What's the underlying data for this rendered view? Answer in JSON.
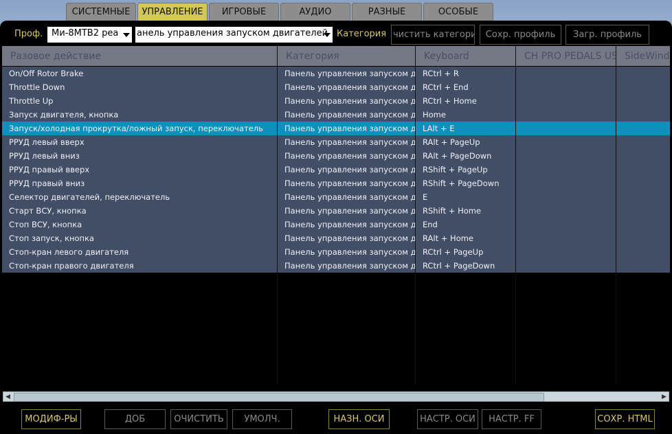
{
  "tabs": [
    "СИСТЕМНЫЕ",
    "УПРАВЛЕНИЕ",
    "ИГРОВЫЕ",
    "АУДИО",
    "РАЗНЫЕ",
    "ОСОБЫЕ"
  ],
  "active_tab": "УПРАВЛЕНИЕ",
  "toolbar": {
    "profile_label": "Проф.",
    "profile_value": "Ми-8МТВ2 реа",
    "category_combo_value": "анель управления запуском двигателей",
    "category_label": "Категория",
    "clear_category": "чистить категори",
    "save_profile": "Сохр. профиль",
    "load_profile": "Загр. профиль"
  },
  "columns": [
    "Разовое действие",
    "Категория",
    "Keyboard",
    "CH PRO PEDALS USE",
    "SideWinde"
  ],
  "rows": [
    {
      "action": "On/Off Rotor Brake",
      "category": "Панель управления запуском двигателей",
      "keyboard": "RCtrl + R"
    },
    {
      "action": "Throttle Down",
      "category": "Панель управления запуском двигателей",
      "keyboard": "RCtrl + End"
    },
    {
      "action": "Throttle Up",
      "category": "Панель управления запуском двигателей",
      "keyboard": "RCtrl + Home"
    },
    {
      "action": "Запуск двигателя, кнопка",
      "category": "Панель управления запуском двигателей",
      "keyboard": "Home"
    },
    {
      "action": "Запуск/холодная прокрутка/ложный запуск, переключатель",
      "category": "Панель управления запуском двигателей",
      "keyboard": "LAlt + E"
    },
    {
      "action": "РРУД левый вверх",
      "category": "Панель управления запуском двигателей",
      "keyboard": "RAlt + PageUp"
    },
    {
      "action": "РРУД левый вниз",
      "category": "Панель управления запуском двигателей",
      "keyboard": "RAlt + PageDown"
    },
    {
      "action": "РРУД правый вверх",
      "category": "Панель управления запуском двигателей",
      "keyboard": "RShift + PageUp"
    },
    {
      "action": "РРУД правый вниз",
      "category": "Панель управления запуском двигателей",
      "keyboard": "RShift + PageDown"
    },
    {
      "action": "Селектор двигателей, переключатель",
      "category": "Панель управления запуском двигателей",
      "keyboard": "E"
    },
    {
      "action": "Старт ВСУ, кнопка",
      "category": "Панель управления запуском двигателей",
      "keyboard": "RShift + Home"
    },
    {
      "action": "Стоп ВСУ, кнопка",
      "category": "Панель управления запуском двигателей",
      "keyboard": "End"
    },
    {
      "action": "Стоп запуск, кнопка",
      "category": "Панель управления запуском двигателей",
      "keyboard": "RAlt + Home"
    },
    {
      "action": "Стоп-кран левого двигателя",
      "category": "Панель управления запуском двигателей",
      "keyboard": "RCtrl + PageUp"
    },
    {
      "action": "Стоп-кран правого двигателя",
      "category": "Панель управления запуском двигателей",
      "keyboard": "RCtrl + PageDown"
    }
  ],
  "selected_row": 4,
  "bottom_buttons": {
    "modifiers": "МОДИФ-РЫ",
    "add": "ДОБ",
    "clear": "ОЧИСТИТЬ",
    "default": "УМОЛЧ.",
    "assign_axes": "НАЗН. ОСИ",
    "axis_settings": "НАСТР. ОСИ",
    "ff_settings": "НАСТР. FF",
    "save_html": "СОХР. HTML"
  },
  "colors": {
    "accent_yellow": "#d8c869",
    "active_tab": "#d3c75a",
    "selected_row": "#0e8fbc"
  }
}
